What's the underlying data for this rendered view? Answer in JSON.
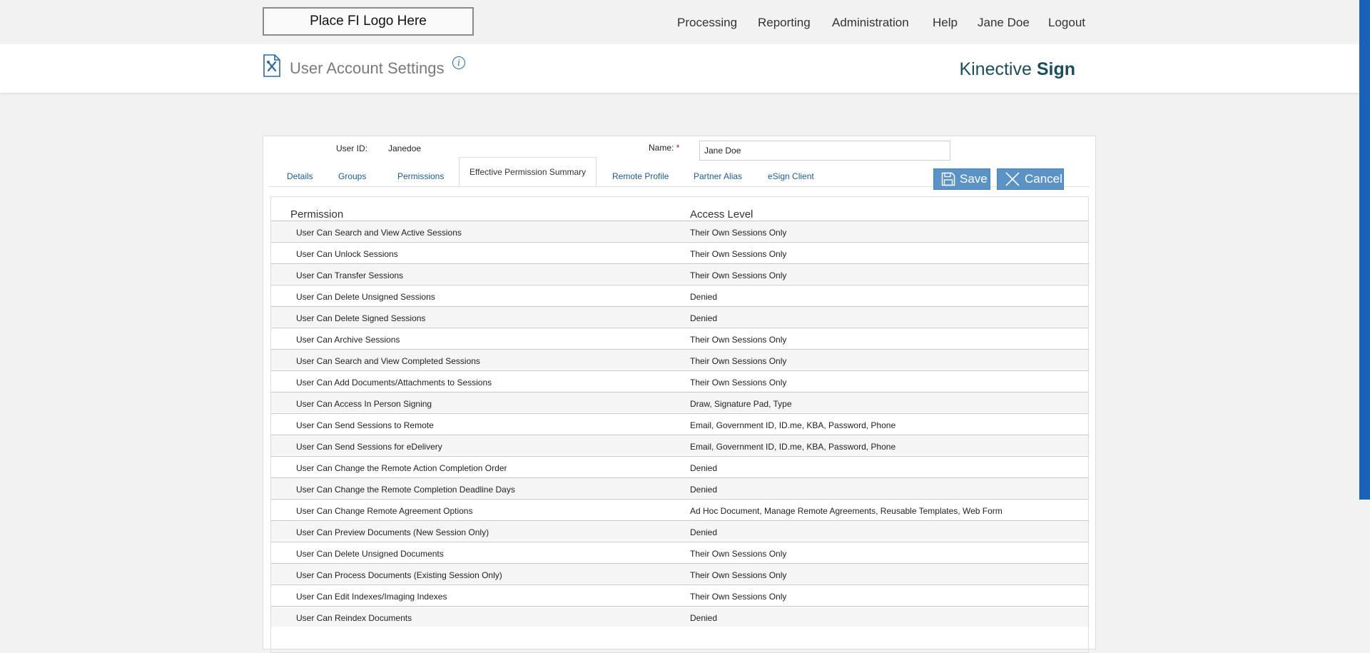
{
  "header": {
    "logo_text": "Place FI Logo Here",
    "nav": [
      "Processing",
      "Reporting",
      "Administration",
      "Help",
      "Jane Doe",
      "Logout"
    ]
  },
  "page": {
    "title": "User Account Settings",
    "info_glyph": "i",
    "brand_light": "Kinective ",
    "brand_bold": "Sign"
  },
  "form": {
    "user_id_label": "User ID:",
    "user_id_value": "Janedoe",
    "name_label": "Name:",
    "required_mark": "*",
    "name_value": "Jane Doe"
  },
  "tabs": [
    "Details",
    "Groups",
    "Permissions",
    "Effective Permission Summary",
    "Remote Profile",
    "Partner Alias",
    "eSign Client"
  ],
  "active_tab": "Effective Permission Summary",
  "buttons": {
    "save_label": "Save",
    "cancel_label": "Cancel"
  },
  "table": {
    "headers": [
      "Permission",
      "Access Level"
    ],
    "rows": [
      [
        "User Can Search and View Active Sessions",
        "Their Own Sessions Only"
      ],
      [
        "User Can Unlock Sessions",
        "Their Own Sessions Only"
      ],
      [
        "User Can Transfer Sessions",
        "Their Own Sessions Only"
      ],
      [
        "User Can Delete Unsigned Sessions",
        "Denied"
      ],
      [
        "User Can Delete Signed Sessions",
        "Denied"
      ],
      [
        "User Can Archive Sessions",
        "Their Own Sessions Only"
      ],
      [
        "User Can Search and View Completed Sessions",
        "Their Own Sessions Only"
      ],
      [
        "User Can Add Documents/Attachments to Sessions",
        "Their Own Sessions Only"
      ],
      [
        "User Can Access In Person Signing",
        "Draw, Signature Pad, Type"
      ],
      [
        "User Can Send Sessions to Remote",
        "Email, Government ID, ID.me, KBA, Password, Phone"
      ],
      [
        "User Can Send Sessions for eDelivery",
        "Email, Government ID, ID.me, KBA, Password, Phone"
      ],
      [
        "User Can Change the Remote Action Completion Order",
        "Denied"
      ],
      [
        "User Can Change the Remote Completion Deadline Days",
        "Denied"
      ],
      [
        "User Can Change Remote Agreement Options",
        "Ad Hoc Document, Manage Remote Agreements, Reusable Templates, Web Form"
      ],
      [
        "User Can Preview Documents (New Session Only)",
        "Denied"
      ],
      [
        "User Can Delete Unsigned Documents",
        "Their Own Sessions Only"
      ],
      [
        "User Can Process Documents (Existing Session Only)",
        "Their Own Sessions Only"
      ],
      [
        "User Can Edit Indexes/Imaging Indexes",
        "Their Own Sessions Only"
      ],
      [
        "User Can Reindex Documents",
        "Denied"
      ]
    ]
  },
  "colors": {
    "brand": "#1c4e5b",
    "link": "#1f5a94",
    "button": "#5b93c7",
    "scrollbar": "#1a62b5"
  },
  "icons": [
    "document-settings-icon",
    "info-icon",
    "floppy-disk-icon",
    "close-x-icon"
  ]
}
